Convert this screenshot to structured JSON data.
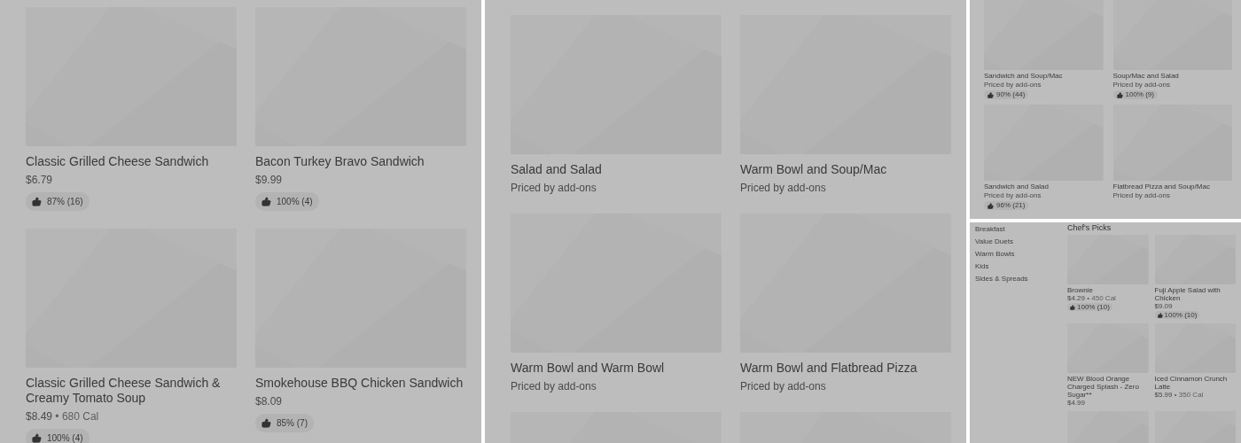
{
  "panels": [
    {
      "kind": "menu",
      "items": [
        {
          "kind": "dish",
          "name": "Classic Grilled Cheese Sandwich",
          "price": "$6.79",
          "rating": "87% (16)"
        },
        {
          "kind": "dish",
          "name": "Bacon Turkey Bravo Sandwich",
          "price": "$9.99",
          "rating": "100% (4)"
        },
        {
          "kind": "dish",
          "name": "Classic Grilled Cheese Sandwich & Creamy Tomato Soup",
          "price": "$8.49",
          "calories": "• 680 Cal",
          "rating": "100% (4)"
        },
        {
          "kind": "dish",
          "name": "Smokehouse BBQ Chicken Sandwich",
          "price": "$8.09",
          "rating": "85% (7)"
        }
      ]
    },
    {
      "kind": "menu",
      "items": [
        {
          "kind": "dish",
          "name": "Salad and Salad",
          "price": "Priced by add-ons"
        },
        {
          "kind": "dish",
          "name": "Warm Bowl and Soup/Mac",
          "price": "Priced by add-ons"
        },
        {
          "kind": "dish",
          "name": "Warm Bowl and Warm Bowl",
          "price": "Priced by add-ons"
        },
        {
          "kind": "dish",
          "name": "Warm Bowl and Flatbread Pizza",
          "price": "Priced by add-ons"
        },
        {
          "kind": "picture"
        },
        {
          "kind": "picture"
        }
      ]
    },
    {
      "kind": "menu",
      "items": [
        {
          "kind": "dish",
          "name": "Sandwich and Soup/Mac",
          "price": "Priced by add-ons",
          "rating": "90% (44)"
        },
        {
          "kind": "dish",
          "name": "Soup/Mac and Salad",
          "price": "Priced by add-ons",
          "rating": "100% (9)"
        },
        {
          "kind": "dish",
          "name": "Sandwich and Salad",
          "price": "Priced by add-ons",
          "rating": "96% (21)"
        },
        {
          "kind": "dish",
          "name": "Flatbread Pizza and Soup/Mac",
          "price": "Priced by add-ons"
        }
      ]
    },
    {
      "kind": "category",
      "sidebar": [
        "Breakfast",
        "Value Duets",
        "Warm Bowls",
        "Kids",
        "Sides & Spreads"
      ],
      "heading": "Chef's Picks",
      "items": [
        {
          "kind": "dish",
          "name": "Brownie",
          "price": "$4.29",
          "calories": "• 450 Cal",
          "rating": "100% (10)"
        },
        {
          "kind": "dish",
          "name": "Fuji Apple Salad with Chicken",
          "price": "$9.09",
          "rating": "100% (10)"
        },
        {
          "kind": "dish",
          "name": "NEW Blood Orange Charged Splash - Zero Sugar**",
          "price": "$4.99"
        },
        {
          "kind": "dish",
          "name": "Iced Cinnamon Crunch Latte",
          "price": "$5.99",
          "calories": "• 350 Cal"
        },
        {
          "kind": "picture"
        },
        {
          "kind": "picture"
        }
      ]
    }
  ]
}
